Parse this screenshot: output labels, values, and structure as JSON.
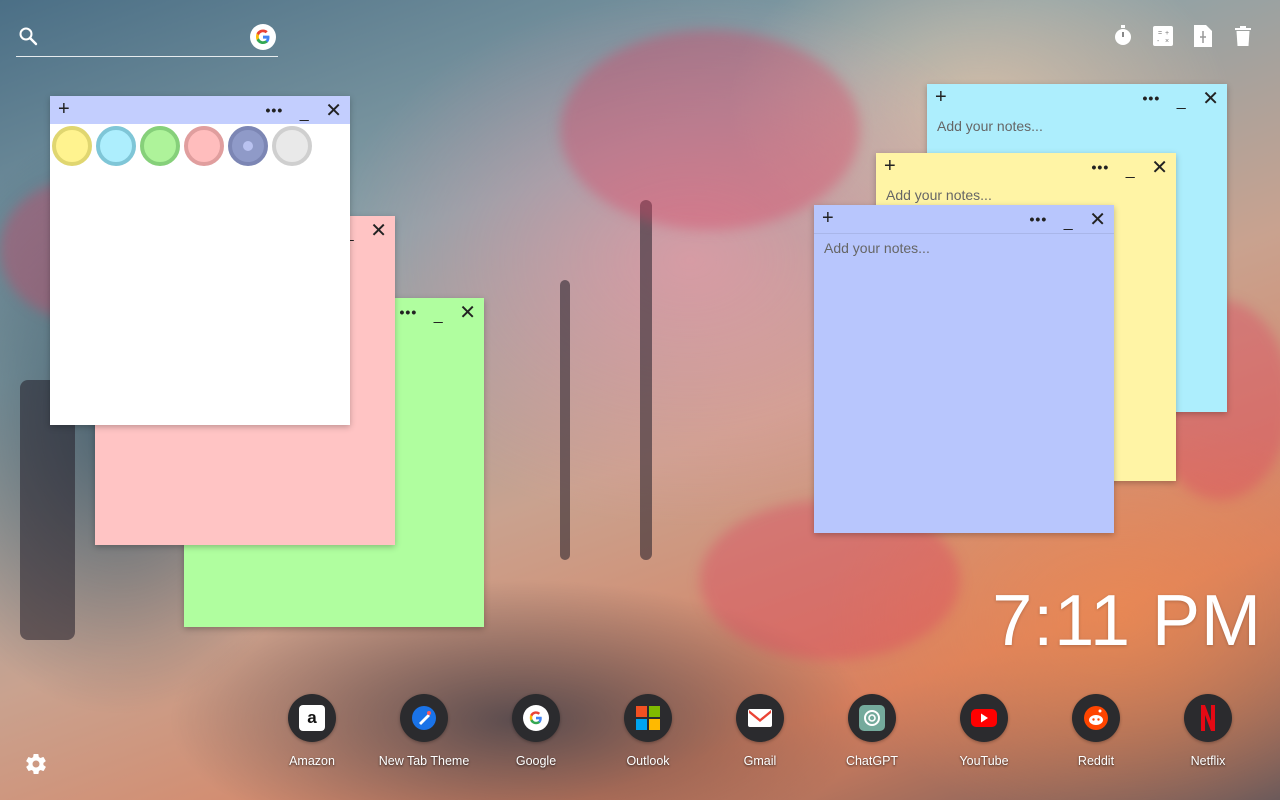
{
  "clock": {
    "time": "7:11 PM"
  },
  "notes": {
    "placeholder": "Add your notes...",
    "colors": {
      "white": "#ffffff",
      "pink": "#ffc4c4",
      "green": "#b0fe9f",
      "cyan": "#adeefd",
      "yellow": "#fff4a5",
      "blue": "#b8c6fd",
      "header_blue": "#c3cefe"
    },
    "swatches": [
      {
        "name": "yellow",
        "fill": "#fff38f",
        "border": "#e0d670"
      },
      {
        "name": "cyan",
        "fill": "#adeefd",
        "border": "#7fc6d7"
      },
      {
        "name": "green",
        "fill": "#aef39a",
        "border": "#86d07a"
      },
      {
        "name": "pink",
        "fill": "#ffbdbd",
        "border": "#e09e9e"
      },
      {
        "name": "blue",
        "fill": "#8f9ac8",
        "border": "#7c86b4"
      },
      {
        "name": "grey",
        "fill": "#e9e9e9",
        "border": "#cfcfcf"
      }
    ]
  },
  "controls": {
    "add": "+",
    "more": "•••",
    "minimize": "_",
    "close": "✕"
  },
  "dock": [
    {
      "label": "Amazon",
      "icon": "amazon-icon"
    },
    {
      "label": "New Tab Theme",
      "icon": "new-tab-theme-icon"
    },
    {
      "label": "Google",
      "icon": "google-icon"
    },
    {
      "label": "Outlook",
      "icon": "outlook-icon"
    },
    {
      "label": "Gmail",
      "icon": "gmail-icon"
    },
    {
      "label": "ChatGPT",
      "icon": "chatgpt-icon"
    },
    {
      "label": "YouTube",
      "icon": "youtube-icon"
    },
    {
      "label": "Reddit",
      "icon": "reddit-icon"
    },
    {
      "label": "Netflix",
      "icon": "netflix-icon"
    }
  ],
  "top_tools": [
    "timer-icon",
    "calculator-icon",
    "notes-icon",
    "trash-icon"
  ]
}
